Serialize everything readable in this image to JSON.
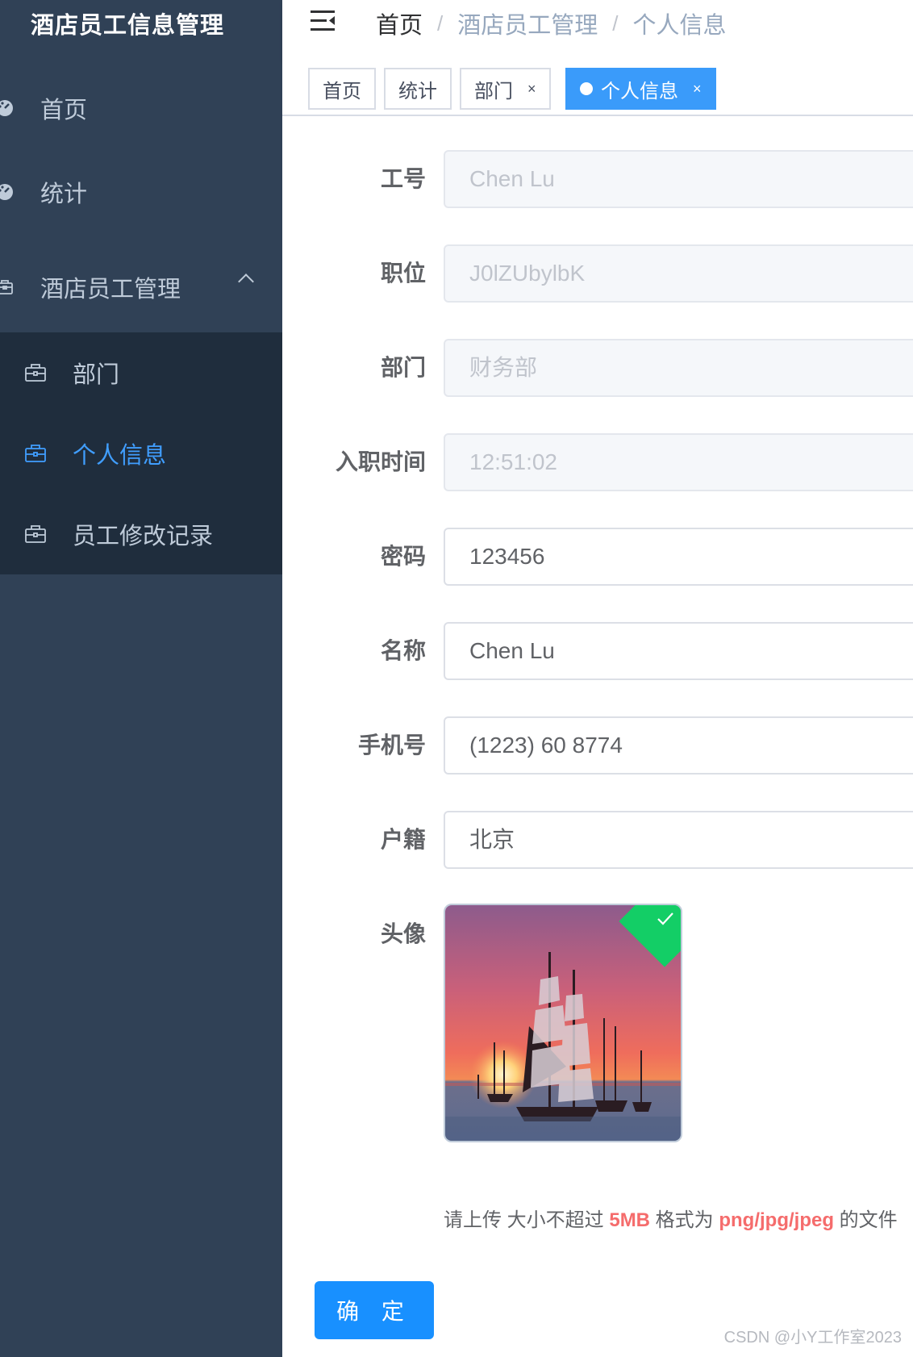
{
  "sidebar": {
    "title": "酒店员工信息管理",
    "items": [
      {
        "label": "首页",
        "icon": "dashboard-icon"
      },
      {
        "label": "统计",
        "icon": "dashboard-icon"
      },
      {
        "label": "酒店员工管理",
        "icon": "briefcase-icon",
        "expanded": true
      }
    ],
    "submenu": [
      {
        "label": "部门",
        "icon": "briefcase-icon"
      },
      {
        "label": "个人信息",
        "icon": "briefcase-icon",
        "active": true
      },
      {
        "label": "员工修改记录",
        "icon": "briefcase-icon"
      }
    ]
  },
  "navbar": {
    "breadcrumb": [
      "首页",
      "酒店员工管理",
      "个人信息"
    ],
    "separator": "/"
  },
  "tags": [
    {
      "label": "首页"
    },
    {
      "label": "统计"
    },
    {
      "label": "部门",
      "closable": true
    },
    {
      "label": "个人信息",
      "closable": true,
      "active": true
    }
  ],
  "tag_close_symbol": "×",
  "form": {
    "fields": [
      {
        "label": "工号",
        "value": "Chen Lu",
        "disabled": true
      },
      {
        "label": "职位",
        "value": "J0lZUbylbK",
        "disabled": true
      },
      {
        "label": "部门",
        "value": "财务部",
        "disabled": true
      },
      {
        "label": "入职时间",
        "value": "12:51:02",
        "disabled": true
      },
      {
        "label": "密码",
        "value": "123456",
        "disabled": false
      },
      {
        "label": "名称",
        "value": "Chen Lu",
        "disabled": false
      },
      {
        "label": "手机号",
        "value": "(1223) 60 8774",
        "disabled": false
      },
      {
        "label": "户籍",
        "value": "北京",
        "disabled": false
      }
    ],
    "avatar_label": "头像",
    "hint": {
      "prefix": "请上传 大小不超过 ",
      "size": "5MB",
      "mid": " 格式为 ",
      "formats": "png/jpg/jpeg",
      "suffix": " 的文件"
    },
    "submit_label": "确 定"
  },
  "watermark": "CSDN @小Y工作室2023",
  "colors": {
    "sidebar_bg": "#304156",
    "submenu_bg": "#1f2d3d",
    "active": "#409eff",
    "primary_button": "#1890ff",
    "upload_success": "#13ce66",
    "hint_highlight": "#f56c6c"
  }
}
